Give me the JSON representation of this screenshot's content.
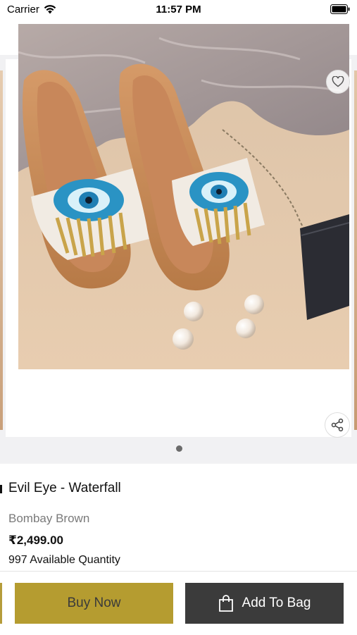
{
  "status_bar": {
    "carrier": "Carrier",
    "time": "11:57 PM"
  },
  "nav": {
    "icons": [
      "back-arrow-icon",
      "search-icon",
      "share-icon",
      "heart-icon",
      "shopping-bag-icon"
    ]
  },
  "gallery": {
    "image_description_icon": "product-image",
    "current_page": 1,
    "total_pages": 1
  },
  "product": {
    "title": "Evil Eye - Waterfall",
    "brand": "Bombay Brown",
    "price": "₹2,499.00",
    "quantity": "997 Available Quantity"
  },
  "actions": {
    "buy_now": "Buy Now",
    "add_to_bag": "Add To Bag"
  },
  "colors": {
    "buy_now_bg": "#b59c30",
    "add_to_bag_bg": "#3b3b3b"
  }
}
